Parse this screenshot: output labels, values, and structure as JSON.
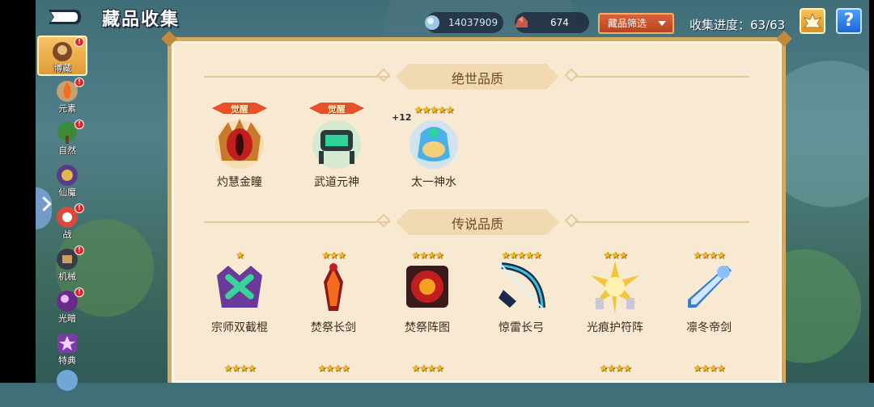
{
  "header": {
    "title": "藏品收集",
    "currency_gem": "14037909",
    "currency_ore": "674",
    "filter_label": "藏品筛选",
    "progress_text": "收集进度：63/63",
    "help_label": "?"
  },
  "sidebar": {
    "items": [
      {
        "label": "博藏",
        "badge": "!"
      },
      {
        "label": "元素",
        "badge": "!"
      },
      {
        "label": "自然",
        "badge": "!"
      },
      {
        "label": "仙魔",
        "badge": "!"
      },
      {
        "label": "战",
        "badge": "!"
      },
      {
        "label": "机械",
        "badge": "!"
      },
      {
        "label": "光暗",
        "badge": "!"
      },
      {
        "label": "特典",
        "badge": ""
      }
    ]
  },
  "sections": [
    {
      "title": "绝世品质",
      "items": [
        {
          "name": "灼慧金瞳",
          "awaken": "觉醒",
          "stars": ""
        },
        {
          "name": "武道元神",
          "awaken": "觉醒",
          "stars": ""
        },
        {
          "name": "太一神水",
          "awaken": "",
          "stars": "★★★★★",
          "plus": "+12"
        }
      ]
    },
    {
      "title": "传说品质",
      "items": [
        {
          "name": "宗师双截棍",
          "stars": "★"
        },
        {
          "name": "焚祭长剑",
          "stars": "★★★"
        },
        {
          "name": "焚祭阵图",
          "stars": "★★★★"
        },
        {
          "name": "惊雷长弓",
          "stars": "★★★★★"
        },
        {
          "name": "光痕护符阵",
          "stars": "★★★"
        },
        {
          "name": "凛冬帝剑",
          "stars": "★★★★"
        }
      ]
    }
  ],
  "colors": {
    "panel_bg": "#f8ead2",
    "panel_border": "#d3aa63",
    "filter_button": "#d9623a",
    "help_button": "#1f64d6",
    "star": "#f4b81a"
  }
}
